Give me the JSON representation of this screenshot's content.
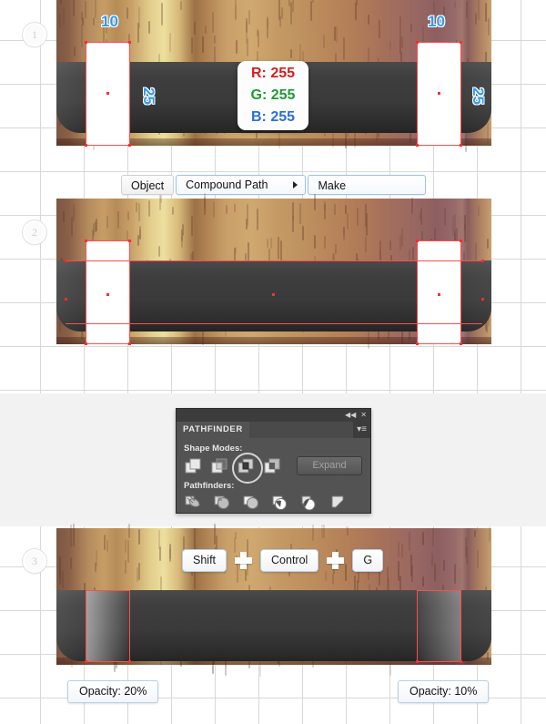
{
  "steps": [
    {
      "number": "1"
    },
    {
      "number": "2"
    },
    {
      "number": "3"
    }
  ],
  "step1": {
    "dim_left_top": "10",
    "dim_right_top": "10",
    "dim_left_side": "25",
    "dim_right_side": "25",
    "tooltip": {
      "r_label": "R: 255",
      "g_label": "G: 255",
      "b_label": "B: 255",
      "r_color": "#d32020",
      "g_color": "#1d9b33",
      "b_color": "#2a6fd6"
    }
  },
  "menu": {
    "items": [
      {
        "label": "Object",
        "highlighted": false,
        "has_caret": false
      },
      {
        "label": "Compound Path",
        "highlighted": true,
        "has_caret": true
      },
      {
        "label": "Make",
        "highlighted": true,
        "has_caret": false
      }
    ]
  },
  "pathfinder": {
    "title": "PATHFINDER",
    "collapse_icon": "◀◀",
    "close_icon": "✕",
    "menu_icon": "▾≡",
    "shape_modes_label": "Shape Modes:",
    "pathfinders_label": "Pathfinders:",
    "expand_label": "Expand",
    "shape_modes": [
      {
        "name": "unite",
        "selected": false
      },
      {
        "name": "minus-front",
        "selected": false
      },
      {
        "name": "intersect",
        "selected": true
      },
      {
        "name": "exclude",
        "selected": false
      }
    ],
    "pathfinder_ops": [
      {
        "name": "divide"
      },
      {
        "name": "trim"
      },
      {
        "name": "merge"
      },
      {
        "name": "crop"
      },
      {
        "name": "outline"
      },
      {
        "name": "minus-back"
      }
    ]
  },
  "step3": {
    "keys": [
      {
        "label": "Shift"
      },
      {
        "label": "Control"
      },
      {
        "label": "G"
      }
    ],
    "opacity_left": "Opacity: 20%",
    "opacity_right": "Opacity: 10%"
  },
  "colors": {
    "accent_blue": "#3399ee",
    "selection_red": "#ff4d4d",
    "panel_dark": "#535353",
    "bar_dark": "#3a3a3a"
  }
}
